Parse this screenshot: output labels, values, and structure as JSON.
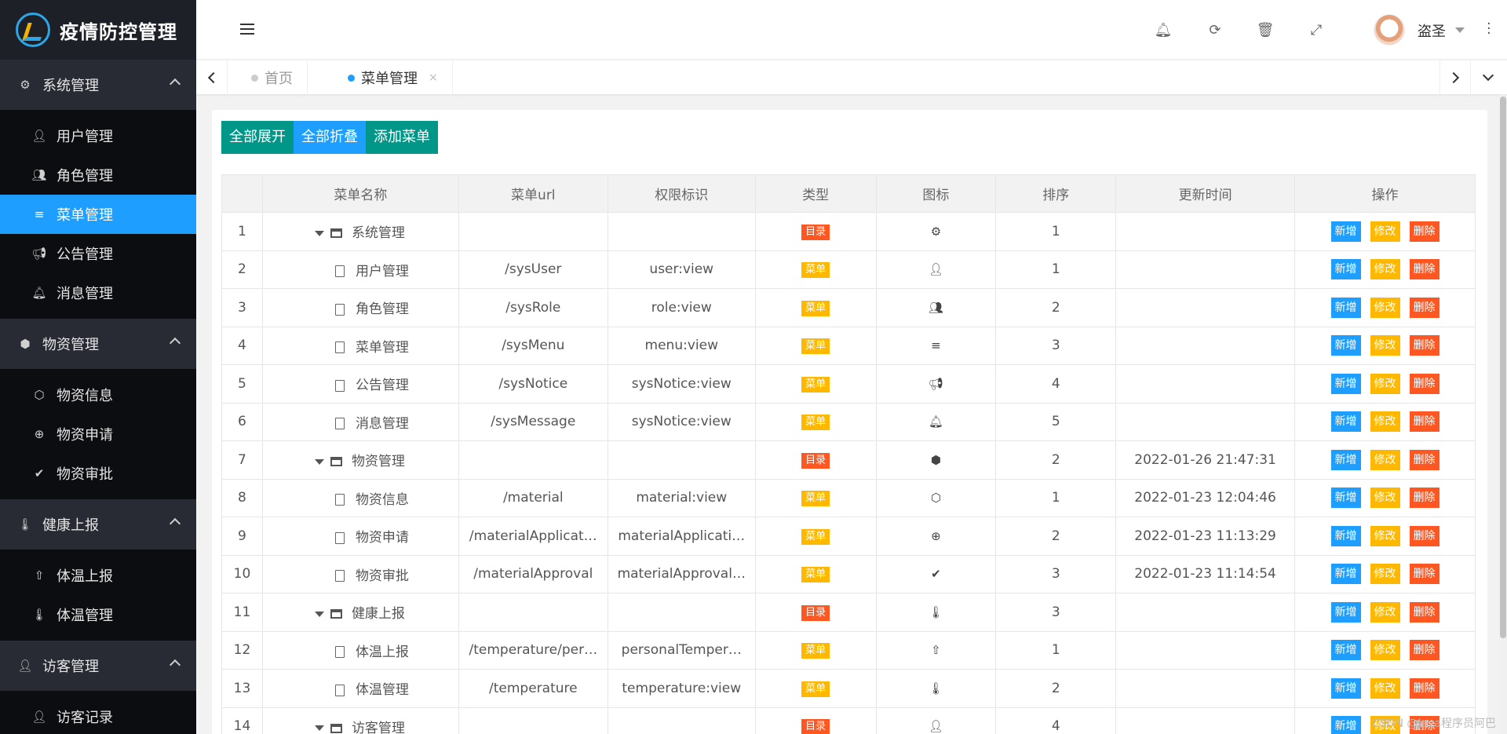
{
  "app": {
    "title": "疫情防控管理"
  },
  "sidebar": {
    "groups": [
      {
        "label": "系统管理",
        "icon": "gear-icon",
        "items": [
          {
            "label": "用户管理",
            "icon": "user-icon"
          },
          {
            "label": "角色管理",
            "icon": "users-icon"
          },
          {
            "label": "菜单管理",
            "icon": "bars-icon",
            "active": true
          },
          {
            "label": "公告管理",
            "icon": "bullhorn-icon"
          },
          {
            "label": "消息管理",
            "icon": "bell-icon"
          }
        ]
      },
      {
        "label": "物资管理",
        "icon": "cube-icon",
        "items": [
          {
            "label": "物资信息",
            "icon": "cubes-icon"
          },
          {
            "label": "物资申请",
            "icon": "plus-circle-icon"
          },
          {
            "label": "物资审批",
            "icon": "check-circle-icon"
          }
        ]
      },
      {
        "label": "健康上报",
        "icon": "thermometer-icon",
        "items": [
          {
            "label": "体温上报",
            "icon": "arrow-up-circle-icon"
          },
          {
            "label": "体温管理",
            "icon": "thermometer-icon"
          }
        ]
      },
      {
        "label": "访客管理",
        "icon": "user-plus-icon",
        "items": [
          {
            "label": "访客记录",
            "icon": "user-secret-icon"
          }
        ]
      }
    ]
  },
  "header": {
    "username": "盗圣"
  },
  "tabs": [
    {
      "label": "首页",
      "active": false
    },
    {
      "label": "菜单管理",
      "active": true,
      "close": "×"
    }
  ],
  "toolbar": {
    "expand_all": "全部展开",
    "collapse_all": "全部折叠",
    "add_menu": "添加菜单"
  },
  "table": {
    "columns": [
      "菜单名称",
      "菜单url",
      "权限标识",
      "类型",
      "图标",
      "排序",
      "更新时间",
      "操作"
    ],
    "ops": {
      "add": "新增",
      "edit": "修改",
      "delete": "删除"
    },
    "rows": [
      {
        "no": "1",
        "name": "系统管理",
        "kind": "folder",
        "url": "",
        "perm": "",
        "type": "目录",
        "icon": "gear-icon",
        "glyph": "⚙",
        "sort": "1",
        "updated": ""
      },
      {
        "no": "2",
        "name": "用户管理",
        "kind": "file",
        "url": "/sysUser",
        "perm": "user:view",
        "type": "菜单",
        "icon": "user-icon",
        "glyph": "👤",
        "sort": "1",
        "updated": ""
      },
      {
        "no": "3",
        "name": "角色管理",
        "kind": "file",
        "url": "/sysRole",
        "perm": "role:view",
        "type": "菜单",
        "icon": "users-icon",
        "glyph": "👥",
        "sort": "2",
        "updated": ""
      },
      {
        "no": "4",
        "name": "菜单管理",
        "kind": "file",
        "url": "/sysMenu",
        "perm": "menu:view",
        "type": "菜单",
        "icon": "bars-icon",
        "glyph": "≡",
        "sort": "3",
        "updated": ""
      },
      {
        "no": "5",
        "name": "公告管理",
        "kind": "file",
        "url": "/sysNotice",
        "perm": "sysNotice:view",
        "type": "菜单",
        "icon": "bullhorn-icon",
        "glyph": "📢",
        "sort": "4",
        "updated": ""
      },
      {
        "no": "6",
        "name": "消息管理",
        "kind": "file",
        "url": "/sysMessage",
        "perm": "sysNotice:view",
        "type": "菜单",
        "icon": "bell-icon",
        "glyph": "🔔",
        "sort": "5",
        "updated": ""
      },
      {
        "no": "7",
        "name": "物资管理",
        "kind": "folder",
        "url": "",
        "perm": "",
        "type": "目录",
        "icon": "cube-icon",
        "glyph": "⬢",
        "sort": "2",
        "updated": "2022-01-26 21:47:31"
      },
      {
        "no": "8",
        "name": "物资信息",
        "kind": "file",
        "url": "/material",
        "perm": "material:view",
        "type": "菜单",
        "icon": "cubes-icon",
        "glyph": "⬡",
        "sort": "1",
        "updated": "2022-01-23 12:04:46"
      },
      {
        "no": "9",
        "name": "物资申请",
        "kind": "file",
        "url": "/materialApplicat…",
        "perm": "materialApplicati…",
        "type": "菜单",
        "icon": "plus-circle-icon",
        "glyph": "⊕",
        "sort": "2",
        "updated": "2022-01-23 11:13:29"
      },
      {
        "no": "10",
        "name": "物资审批",
        "kind": "file",
        "url": "/materialApproval",
        "perm": "materialApproval…",
        "type": "菜单",
        "icon": "check-circle-icon",
        "glyph": "✔",
        "sort": "3",
        "updated": "2022-01-23 11:14:54"
      },
      {
        "no": "11",
        "name": "健康上报",
        "kind": "folder",
        "url": "",
        "perm": "",
        "type": "目录",
        "icon": "thermometer-icon",
        "glyph": "🌡",
        "sort": "3",
        "updated": ""
      },
      {
        "no": "12",
        "name": "体温上报",
        "kind": "file",
        "url": "/temperature/per…",
        "perm": "personalTemper…",
        "type": "菜单",
        "icon": "arrow-up-circle-icon",
        "glyph": "⇧",
        "sort": "1",
        "updated": ""
      },
      {
        "no": "13",
        "name": "体温管理",
        "kind": "file",
        "url": "/temperature",
        "perm": "temperature:view",
        "type": "菜单",
        "icon": "thermometer-icon",
        "glyph": "🌡",
        "sort": "2",
        "updated": ""
      },
      {
        "no": "14",
        "name": "访客管理",
        "kind": "folder",
        "url": "",
        "perm": "",
        "type": "目录",
        "icon": "user-plus-icon",
        "glyph": "👤",
        "sort": "4",
        "updated": ""
      }
    ]
  },
  "watermark": "CSDN @Java程序员阿巴",
  "colors": {
    "primary": "#1e9fff",
    "green": "#009688",
    "warn": "#ffb800",
    "danger": "#ff5722",
    "sidebar": "#191a1f"
  }
}
